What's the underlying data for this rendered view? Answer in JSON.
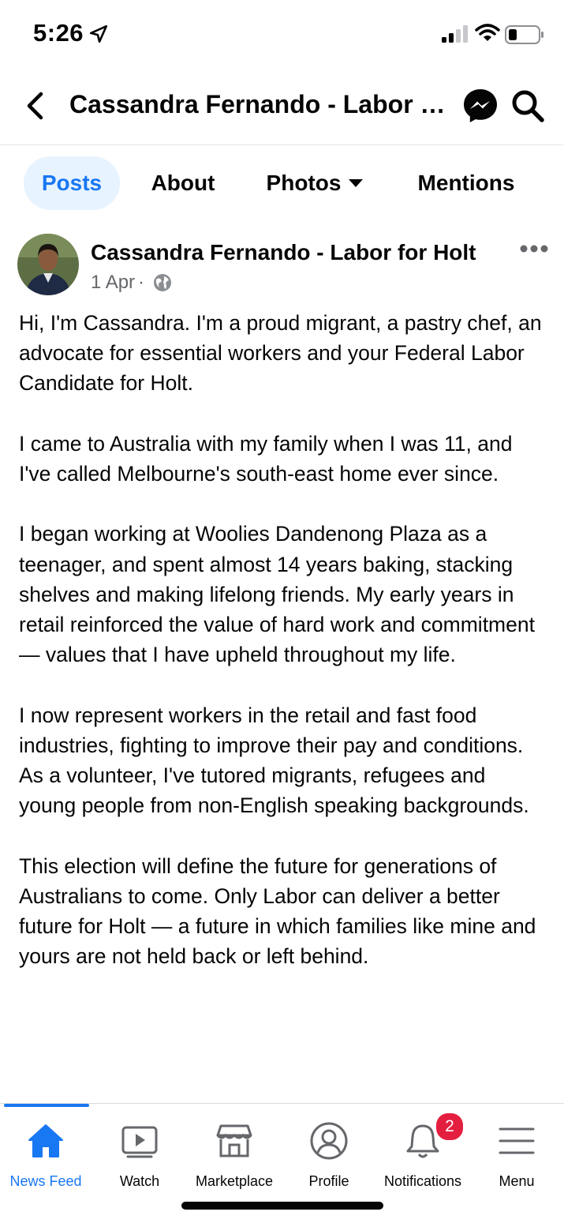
{
  "status_bar": {
    "time": "5:26"
  },
  "header": {
    "title": "Cassandra Fernando - Labor for Holt"
  },
  "tabs": [
    {
      "label": "Posts"
    },
    {
      "label": "About"
    },
    {
      "label": "Photos"
    },
    {
      "label": "Mentions"
    }
  ],
  "post": {
    "author": "Cassandra Fernando - Labor for Holt",
    "date": "1 Apr",
    "separator": "·",
    "paragraphs": [
      "Hi, I'm Cassandra. I'm a proud migrant, a pastry chef, an advocate for essential workers and your Federal Labor Candidate for Holt.",
      "I came to Australia with my family when I was 11, and I've called Melbourne's south-east home ever since.",
      "I began working at Woolies Dandenong Plaza as a teenager, and spent almost 14 years baking, stacking shelves and making lifelong friends. My early years in retail reinforced the value of hard work and commitment — values that I have upheld throughout my life.",
      "I now represent workers in the retail and fast food industries, fighting to improve their pay and conditions. As a volunteer, I've tutored migrants, refugees and young people from non-English speaking backgrounds.",
      "This election will define the future for generations of Australians to come. Only Labor can deliver a better future for Holt — a future in which families like mine and yours are not held back or left behind."
    ]
  },
  "bottom_nav": {
    "items": [
      {
        "label": "News Feed",
        "icon": "home-icon"
      },
      {
        "label": "Watch",
        "icon": "video-icon"
      },
      {
        "label": "Marketplace",
        "icon": "shop-icon"
      },
      {
        "label": "Profile",
        "icon": "profile-icon"
      },
      {
        "label": "Notifications",
        "icon": "bell-icon"
      },
      {
        "label": "Menu",
        "icon": "menu-icon"
      }
    ],
    "notifications_badge": "2"
  },
  "colors": {
    "accent": "#1877f2",
    "badge": "#e41e3f",
    "tab_active_bg": "#e7f3ff",
    "secondary_text": "#65676b"
  }
}
